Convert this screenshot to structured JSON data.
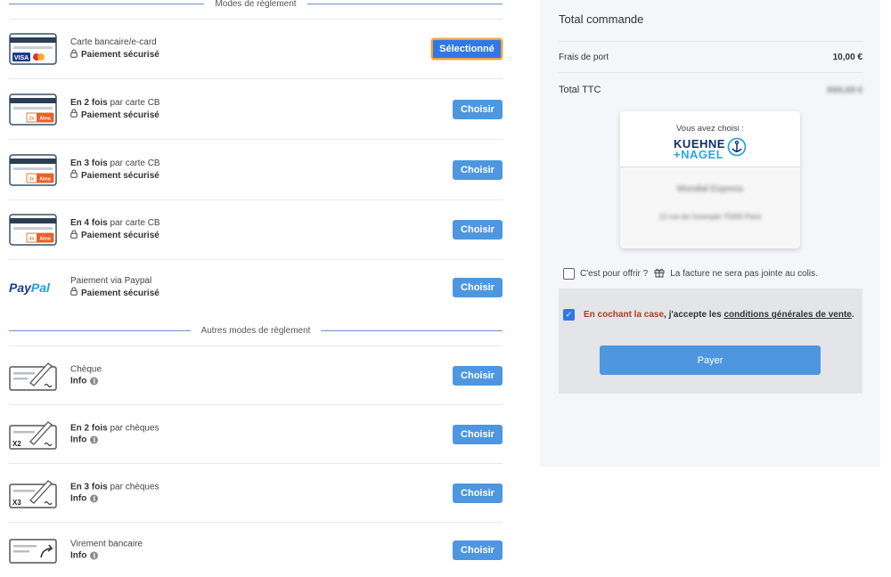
{
  "left": {
    "section_online": "Modes de règlement",
    "section_other": "Autres modes de règlement",
    "secure_label": "Paiement sécurisé",
    "info_label": "Info",
    "choose_label": "Choisir",
    "selected_label": "Sélectionné",
    "methods": [
      {
        "line1": "Carte bancaire/e-card",
        "icon": "credit-card-visa-mastercard-icon"
      },
      {
        "bold": "En 2 fois",
        "rest": " par carte CB",
        "badge": "2x Alma",
        "icon": "card-2x-alma-icon"
      },
      {
        "bold": "En 3 fois",
        "rest": " par carte CB",
        "badge": "3x Alma",
        "icon": "card-3x-alma-icon"
      },
      {
        "bold": "En 4 fois",
        "rest": " par carte CB",
        "badge": "4x Alma",
        "icon": "card-4x-alma-icon"
      },
      {
        "line1": "Paiement via Paypal",
        "logo_a": "Pay",
        "logo_b": "Pal",
        "icon": "paypal-logo-icon"
      }
    ],
    "other_methods": [
      {
        "line1": "Chèque",
        "icon": "cheque-icon"
      },
      {
        "bold": "En 2 fois",
        "rest": " par chèques",
        "mark": "X2",
        "icon": "cheque-x2-icon"
      },
      {
        "bold": "En 3 fois",
        "rest": " par chèques",
        "mark": "X3",
        "icon": "cheque-x3-icon"
      },
      {
        "line1": "Virement bancaire",
        "icon": "bank-transfer-icon"
      }
    ]
  },
  "right": {
    "title": "Total commande",
    "shipping_label": "Frais de port",
    "shipping_value": "10,00 €",
    "total_label": "Total TTC",
    "total_value": "XXX,XX €",
    "carrier_chosen": "Vous avez choisi :",
    "carrier_logo_top": "KUEHNE",
    "carrier_logo_bottom": "+NAGEL",
    "carrier_name": "Mondial Express",
    "carrier_address": "12 rue de l'exemple 75000 Paris",
    "gift_label": "C'est pour offrir ?",
    "gift_note": "La facture ne sera pas jointe au colis.",
    "cgv_part1": "En cochant la case",
    "cgv_part2": ", j'accepte les ",
    "cgv_link": "conditions générales de vente",
    "cgv_end": ".",
    "pay_button": "Payer"
  }
}
